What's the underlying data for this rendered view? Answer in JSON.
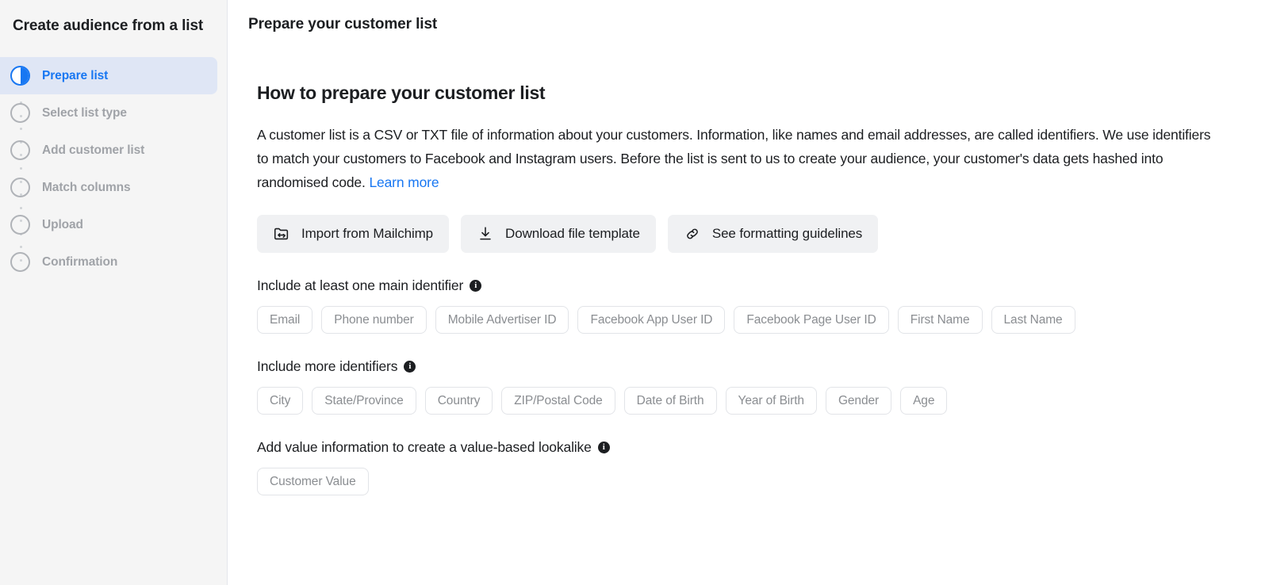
{
  "sidebar": {
    "title": "Create audience from a list",
    "steps": [
      {
        "label": "Prepare list",
        "state": "active",
        "icon": "half-filled-circle-icon"
      },
      {
        "label": "Select list type",
        "state": "pending",
        "icon": "empty-circle-icon"
      },
      {
        "label": "Add customer list",
        "state": "pending",
        "icon": "empty-circle-icon"
      },
      {
        "label": "Match columns",
        "state": "pending",
        "icon": "empty-circle-icon"
      },
      {
        "label": "Upload",
        "state": "pending",
        "icon": "empty-circle-icon"
      },
      {
        "label": "Confirmation",
        "state": "pending",
        "icon": "empty-circle-icon"
      }
    ]
  },
  "header": {
    "title": "Prepare your customer list"
  },
  "main": {
    "section_title": "How to prepare your customer list",
    "body_part1": "A customer list is a CSV or TXT file of information about your customers. Information, like names and email addresses, are called identifiers. We use identifiers to match your customers to Facebook and Instagram users. Before the list is sent to us to create your audience, your customer's data gets hashed into randomised code. ",
    "body_link": "Learn more",
    "actions": [
      {
        "label": "Import from Mailchimp",
        "icon": "folder-import-icon"
      },
      {
        "label": "Download file template",
        "icon": "download-icon"
      },
      {
        "label": "See formatting guidelines",
        "icon": "link-icon"
      }
    ],
    "groups": [
      {
        "label": "Include at least one main identifier",
        "info_icon": "info-icon",
        "chips": [
          "Email",
          "Phone number",
          "Mobile Advertiser ID",
          "Facebook App User ID",
          "Facebook Page User ID",
          "First Name",
          "Last Name"
        ]
      },
      {
        "label": "Include more identifiers",
        "info_icon": "info-icon",
        "chips": [
          "City",
          "State/Province",
          "Country",
          "ZIP/Postal Code",
          "Date of Birth",
          "Year of Birth",
          "Gender",
          "Age"
        ]
      },
      {
        "label": "Add value information to create a value-based lookalike",
        "info_icon": "info-icon",
        "chips": [
          "Customer Value"
        ]
      }
    ]
  },
  "colors": {
    "accent": "#1877f2",
    "sidebar_bg": "#f5f5f5",
    "active_step_bg": "#dfe6f5",
    "button_bg": "#f0f1f3",
    "chip_border": "#e2e4e8",
    "muted_text": "#8a8d91"
  },
  "info_glyph": "i"
}
